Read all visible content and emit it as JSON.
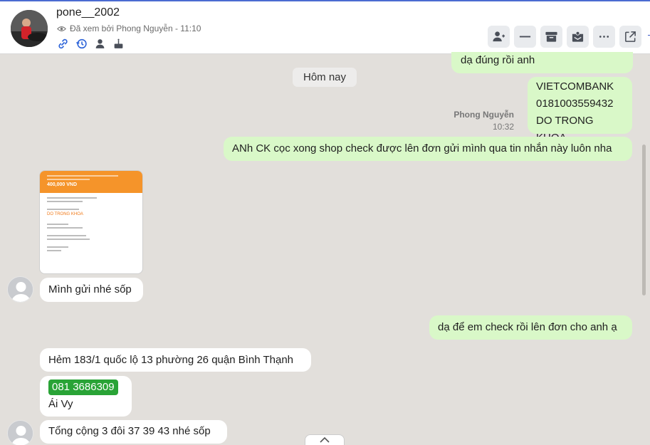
{
  "header": {
    "name": "pone__2002",
    "seen_text": "Đã xem bởi Phong Nguyễn - 11:10",
    "icons": [
      "link-icon",
      "history-icon",
      "person-icon",
      "birthday-cake-icon"
    ],
    "toolbar": [
      "add-user-icon",
      "minimize-icon",
      "archive-icon",
      "inbox-icon",
      "more-icon",
      "external-link-icon"
    ]
  },
  "chat": {
    "date_separator": "Hôm nay",
    "msg_top_out": "dạ đúng rồi anh",
    "bank_lines": [
      "VIETCOMBANK",
      "0181003559432",
      "DO TRONG KHOA"
    ],
    "bank_sender": "Phong Nguyễn",
    "bank_time": "10:32",
    "msg_ck": "ANh CK cọc xong shop check được lên đơn gửi mình qua tin nhắn này luôn nha",
    "receipt": {
      "amount": "400,000 VND",
      "name": "DO TRONG KHOA"
    },
    "msg_sent_photo": "Mình gửi nhé sốp",
    "msg_check": "dạ để em check rồi lên đơn cho anh ạ",
    "msg_address": "Hẻm 183/1 quốc lộ 13 phường 26 quận Bình Thạnh",
    "phone": "081 3686309",
    "contact_name": "Ái Vy",
    "msg_total": "Tổng cộng 3 đôi 37 39 43 nhé sốp"
  }
}
